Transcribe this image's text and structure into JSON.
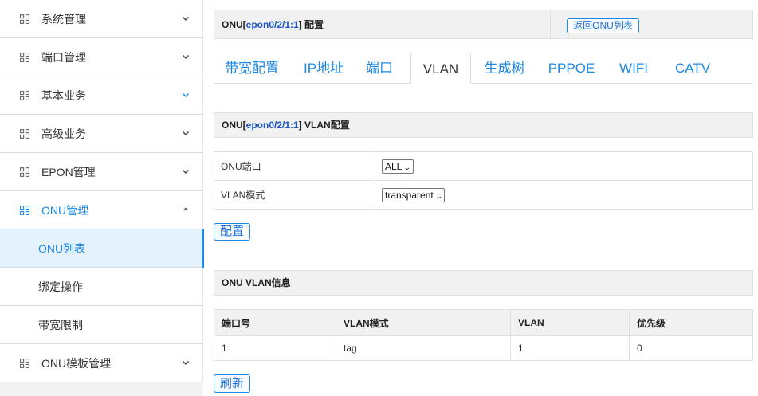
{
  "sidebar": {
    "items": [
      {
        "label": "系统管理"
      },
      {
        "label": "端口管理"
      },
      {
        "label": "基本业务"
      },
      {
        "label": "高级业务"
      },
      {
        "label": "EPON管理"
      },
      {
        "label": "ONU管理"
      }
    ],
    "subitems": [
      {
        "label": "ONU列表"
      },
      {
        "label": "绑定操作"
      },
      {
        "label": "带宽限制"
      }
    ],
    "last_item": {
      "label": "ONU模板管理"
    }
  },
  "header": {
    "prefix": "ONU[",
    "onu_id": "epon0/2/1:1",
    "suffix": "] 配置",
    "back_label": "返回ONU列表"
  },
  "tabs": [
    {
      "label": "带宽配置"
    },
    {
      "label": "IP地址"
    },
    {
      "label": "端口"
    },
    {
      "label": "VLAN"
    },
    {
      "label": "生成树"
    },
    {
      "label": "PPPOE"
    },
    {
      "label": "WIFI"
    },
    {
      "label": "CATV"
    }
  ],
  "vlan_config": {
    "prefix": "ONU[",
    "onu_id": "epon0/2/1:1",
    "suffix": "] VLAN配置",
    "port_label": "ONU端口",
    "port_value": "ALL",
    "mode_label": "VLAN模式",
    "mode_value": "transparent",
    "config_button": "配置"
  },
  "vlan_info": {
    "title": "ONU VLAN信息",
    "columns": [
      "端口号",
      "VLAN模式",
      "VLAN",
      "优先级"
    ],
    "rows": [
      [
        "1",
        "tag",
        "1",
        "0"
      ]
    ],
    "refresh_button": "刷新"
  },
  "colors": {
    "accent": "#1e88e5",
    "highlight_text": "#1a56c8",
    "header_bg": "#f1f1f1"
  }
}
